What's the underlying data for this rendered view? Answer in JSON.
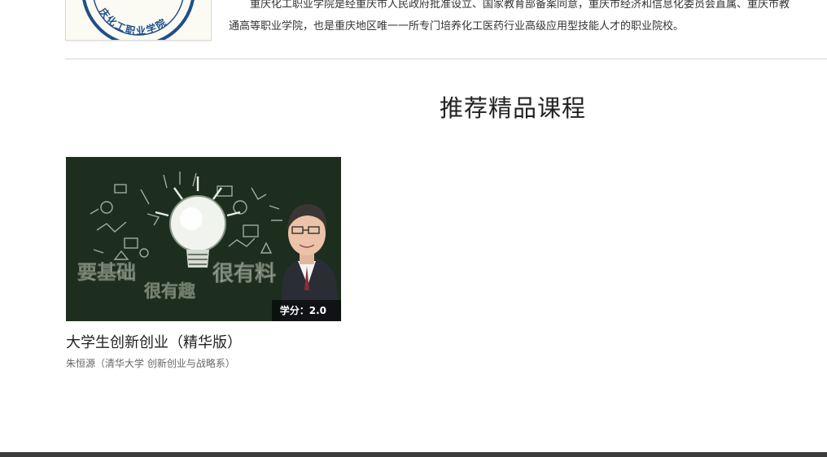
{
  "logo": {
    "text": "庆化工职业学院",
    "icon": "college-seal-logo"
  },
  "intro": {
    "line1": "重庆化工职业学院是经重庆市人民政府批准设立、国家教育部备案同意，重庆市经济和信息化委员会直属、重庆市教",
    "line2": "通高等职业学院，也是重庆地区唯一一所专门培养化工医药行业高级应用型技能人才的职业院校。"
  },
  "section": {
    "title": "推荐精品课程"
  },
  "courses": [
    {
      "title": "大学生创新创业（精华版）",
      "author": "朱恒源（清华大学 创新创业与战略系）",
      "credit": "学分：2.0",
      "thumb_words": [
        "要基础",
        "很有趣",
        "很有料"
      ],
      "thumb_bg": "#1d2e1f",
      "icon": "lightbulb-chalkboard-image"
    }
  ],
  "colors": {
    "footer": "#3b3b3b",
    "divider": "#d6d6d6"
  }
}
